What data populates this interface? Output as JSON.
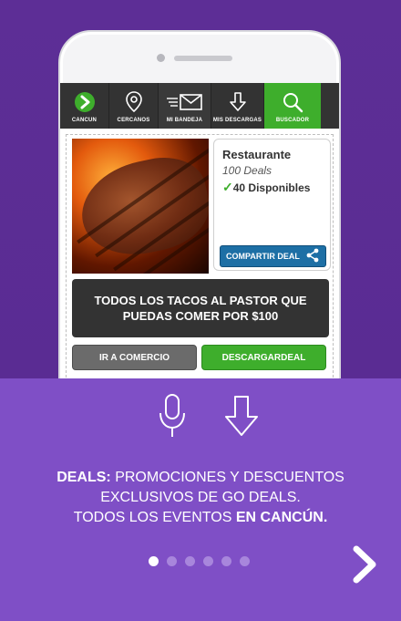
{
  "nav": {
    "items": [
      {
        "label": "CANCUN",
        "icon": "go-logo-icon"
      },
      {
        "label": "CERCANOS",
        "icon": "location-pin-icon"
      },
      {
        "label": "MI BANDEJA",
        "icon": "envelope-icon"
      },
      {
        "label": "MIS DESCARGAS",
        "icon": "download-icon"
      },
      {
        "label": "BUSCADOR",
        "icon": "search-icon"
      }
    ],
    "active_index": 4
  },
  "deal": {
    "category": "Restaurante",
    "deals_count": "100 Deals",
    "available": "40 Disponibles",
    "share_label": "COMPARTIR DEAL",
    "title": "TODOS LOS TACOS AL PASTOR QUE PUEDAS COMER POR $100",
    "go_store_label": "IR A COMERCIO",
    "download_label_prefix": "DESCARGAR ",
    "download_label_bold": "DEAL"
  },
  "feature": {
    "line1_bold": "DEALS:",
    "line1_rest": " PROMOCIONES Y DESCUENTOS",
    "line2": "EXCLUSIVOS DE GO DEALS.",
    "line3_rest": "TODOS LOS EVENTOS ",
    "line3_bold": "EN CANCÚN."
  },
  "pagination": {
    "total": 6,
    "current": 1
  },
  "colors": {
    "background_top": "#5d2e96",
    "background_bottom": "#7f4fc6",
    "accent_green": "#3eae2c",
    "nav_dark": "#333333",
    "share_blue": "#1d6fa5"
  }
}
